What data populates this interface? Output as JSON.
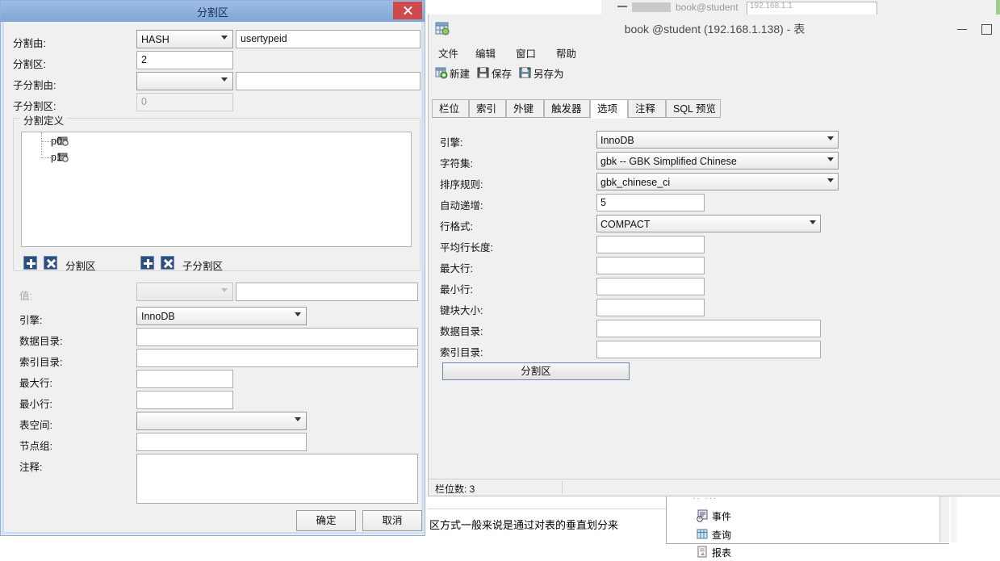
{
  "background": {
    "top_window": {
      "title_fragment": "book@student",
      "box_text": "192.168.1.1"
    },
    "doc_text_fragment": "区方式一般来说是通过对表的垂直划分来",
    "tree_items": [
      {
        "label": "事件",
        "icon": "event-icon"
      },
      {
        "label": "查询",
        "icon": "query-icon"
      },
      {
        "label": "报表",
        "icon": "report-icon"
      }
    ]
  },
  "table_window": {
    "title": "book @student (192.168.1.138) - 表",
    "icon": "table-window-icon",
    "window_buttons": [
      {
        "name": "minimize",
        "glyph": "minimize-icon"
      },
      {
        "name": "maximize",
        "glyph": "maximize-icon"
      }
    ],
    "menu": [
      {
        "label": "文件"
      },
      {
        "label": "编辑"
      },
      {
        "label": "窗口"
      },
      {
        "label": "帮助"
      }
    ],
    "toolbar": [
      {
        "label": "新建",
        "icon": "new-icon"
      },
      {
        "label": "保存",
        "icon": "save-icon"
      },
      {
        "label": "另存为",
        "icon": "save-as-icon"
      }
    ],
    "tabs": [
      {
        "label": "栏位",
        "active": false
      },
      {
        "label": "索引",
        "active": false
      },
      {
        "label": "外键",
        "active": false
      },
      {
        "label": "触发器",
        "active": false
      },
      {
        "label": "选项",
        "active": true
      },
      {
        "label": "注释",
        "active": false
      },
      {
        "label": "SQL 预览",
        "active": false
      }
    ],
    "options": [
      {
        "label": "引擎:",
        "value": "InnoDB",
        "type": "combo"
      },
      {
        "label": "字符集:",
        "value": "gbk -- GBK Simplified Chinese",
        "type": "combo"
      },
      {
        "label": "排序规则:",
        "value": "gbk_chinese_ci",
        "type": "combo"
      },
      {
        "label": "自动递增:",
        "value": "5",
        "type": "text"
      },
      {
        "label": "行格式:",
        "value": "COMPACT",
        "type": "combo"
      },
      {
        "label": "平均行长度:",
        "value": "",
        "type": "text"
      },
      {
        "label": "最大行:",
        "value": "",
        "type": "text"
      },
      {
        "label": "最小行:",
        "value": "",
        "type": "text"
      },
      {
        "label": "键块大小:",
        "value": "",
        "type": "text"
      },
      {
        "label": "数据目录:",
        "value": "",
        "type": "text-wide"
      },
      {
        "label": "索引目录:",
        "value": "",
        "type": "text-wide"
      }
    ],
    "partition_button": "分割区",
    "status": "栏位数: 3"
  },
  "dialog": {
    "title": "分割区",
    "close_icon": "close-icon",
    "fields": {
      "partition_by_label": "分割由:",
      "partition_by_value": "HASH",
      "partition_by_expr": "usertypeid",
      "partitions_label": "分割区:",
      "partitions_value": "2",
      "subpartition_by_label": "子分割由:",
      "subpartition_by_value": "",
      "subpartition_by_expr": "",
      "subpartitions_label": "子分割区:",
      "subpartitions_value": "0"
    },
    "group_title": "分割定义",
    "tree_items": [
      {
        "label": "p0",
        "icon": "partition-icon"
      },
      {
        "label": "p1",
        "icon": "partition-icon"
      }
    ],
    "toolbars": [
      {
        "add_icon": "add-icon",
        "delete_icon": "delete-icon",
        "label": "分割区"
      },
      {
        "add_icon": "add-icon",
        "delete_icon": "delete-icon",
        "label": "子分割区"
      }
    ],
    "detail": {
      "value_label": "值:",
      "value_combo": "",
      "value_text": "",
      "engine_label": "引擎:",
      "engine_value": "InnoDB",
      "data_dir_label": "数据目录:",
      "data_dir_value": "",
      "index_dir_label": "索引目录:",
      "index_dir_value": "",
      "max_rows_label": "最大行:",
      "max_rows_value": "",
      "min_rows_label": "最小行:",
      "min_rows_value": "",
      "tablespace_label": "表空间:",
      "tablespace_value": "",
      "nodegroup_label": "节点组:",
      "nodegroup_value": "",
      "comment_label": "注释:",
      "comment_value": ""
    },
    "ok_button": "确定",
    "cancel_button": "取消"
  },
  "colors": {
    "dialog_title_bar": "#8fb0d9",
    "close_button": "#cf4b4b",
    "window_bg": "#f0f0f0",
    "accent_blue": "#2b4f81"
  }
}
